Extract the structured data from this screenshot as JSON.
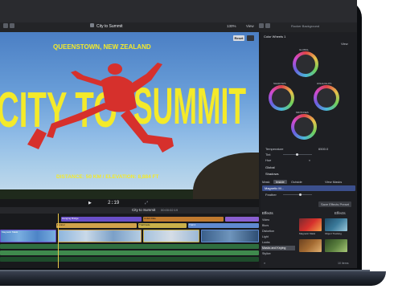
{
  "window": {
    "project_title": "City to Summit",
    "zoom_level": "130%",
    "view_menu": "View",
    "effect_title": "Rocker Background",
    "reset_label": "Reset"
  },
  "viewer": {
    "location_line": "QUEENSTOWN, NEW ZEALAND",
    "headline_left": "CITY TO",
    "headline_right": "SUMMIT",
    "stats_line": "DISTANCE: 50 KM / ELEVATION: 8,884 FT",
    "timecode": "2:19"
  },
  "inspector": {
    "title": "Color Wheels 1",
    "view_label": "View",
    "wheels": [
      "GLOBAL",
      "SHADOWS",
      "HIGHLIGHTS",
      "MIDTONES"
    ],
    "params": [
      {
        "label": "Temperature",
        "value": "6500.0"
      },
      {
        "label": "Tint",
        "value": "0"
      },
      {
        "label": "Hue",
        "value": "0"
      }
    ],
    "sections": [
      "Global",
      "Shadows"
    ],
    "mask_label": "Mask",
    "mask_tabs": [
      "Inside",
      "Outside"
    ],
    "view_masks_label": "View Masks",
    "mask_item": "Magnetic M...",
    "feather_label": "Feather",
    "save_preset": "Save Effects Preset"
  },
  "timeline": {
    "index_label": "City to Summit",
    "timecode": "00:00:02:19",
    "clips": [
      {
        "label": "Magnetic Mask",
        "color": "#6a4fc8"
      },
      {
        "label": "Hanging Bridge",
        "color": "#8a5fd0"
      },
      {
        "label": "Unfelt Ride",
        "color": "#c07a2f"
      },
      {
        "label": "Trail 2",
        "color": "#5f8ad0"
      },
      {
        "label": "Runner",
        "color": "#d0a24a"
      },
      {
        "label": "Trail Fade",
        "color": "#c9b04a"
      }
    ]
  },
  "effects": {
    "title": "Effects",
    "installed_label": "Installed Effects",
    "categories": [
      "Video",
      "Blurs",
      "Distortion",
      "Light",
      "Looks",
      "Masks and Keying",
      "Stylize"
    ],
    "thumbs": [
      {
        "label": "Magnetic Mask",
        "color": "#b8424a"
      },
      {
        "label": "Object Tracking",
        "color": "#3b7a9a"
      },
      {
        "label": "Tilt Shift",
        "color": "#a46b32"
      },
      {
        "label": "Bokeh",
        "color": "#5a7f3e"
      }
    ],
    "count": "10 items"
  },
  "colors": {
    "accent_yellow": "#f4ea2a",
    "runner_red": "#d6302c",
    "sky_blue": "#6a9fd9"
  }
}
